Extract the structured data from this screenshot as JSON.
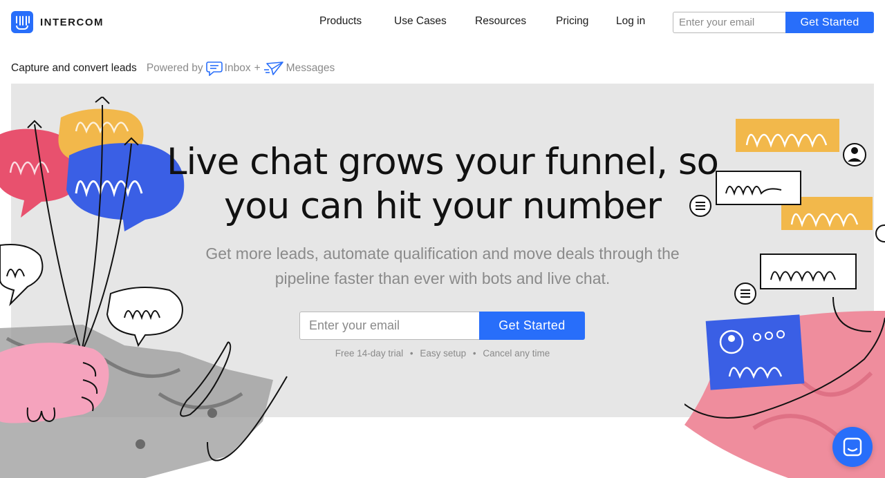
{
  "brand": {
    "name": "INTERCOM",
    "color": "#286efa"
  },
  "nav": {
    "links": [
      "Products",
      "Use Cases",
      "Resources",
      "Pricing",
      "Log in"
    ],
    "email_placeholder": "Enter your email",
    "cta_label": "Get Started"
  },
  "subheader": {
    "title": "Capture and convert leads",
    "powered_by": "Powered by",
    "product_1": "Inbox",
    "plus": "+",
    "product_2": "Messages"
  },
  "hero": {
    "title_line_1": "Live chat grows your funnel, so",
    "title_line_2": "you can hit your number",
    "subtitle_line_1": "Get more leads, automate qualification and move deals through the",
    "subtitle_line_2": "pipeline faster than ever with bots and live chat.",
    "email_placeholder": "Enter your email",
    "cta_label": "Get Started",
    "notes": [
      "Free 14-day trial",
      "Easy setup",
      "Cancel any time"
    ],
    "separator": "•"
  },
  "icons": {
    "logo": "intercom-logo-icon",
    "inbox": "chat-bubble-icon",
    "messages": "paper-plane-icon",
    "launcher": "messenger-launcher-icon"
  }
}
